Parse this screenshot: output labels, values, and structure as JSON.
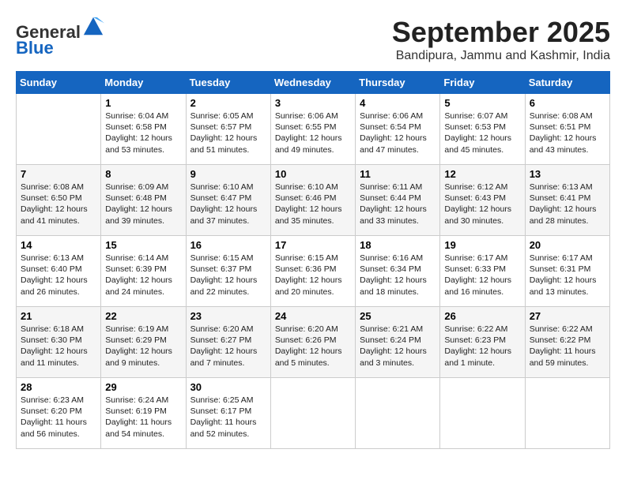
{
  "header": {
    "logo_line1": "General",
    "logo_line2": "Blue",
    "month": "September 2025",
    "location": "Bandipura, Jammu and Kashmir, India"
  },
  "weekdays": [
    "Sunday",
    "Monday",
    "Tuesday",
    "Wednesday",
    "Thursday",
    "Friday",
    "Saturday"
  ],
  "weeks": [
    [
      {
        "day": "",
        "info": ""
      },
      {
        "day": "1",
        "info": "Sunrise: 6:04 AM\nSunset: 6:58 PM\nDaylight: 12 hours\nand 53 minutes."
      },
      {
        "day": "2",
        "info": "Sunrise: 6:05 AM\nSunset: 6:57 PM\nDaylight: 12 hours\nand 51 minutes."
      },
      {
        "day": "3",
        "info": "Sunrise: 6:06 AM\nSunset: 6:55 PM\nDaylight: 12 hours\nand 49 minutes."
      },
      {
        "day": "4",
        "info": "Sunrise: 6:06 AM\nSunset: 6:54 PM\nDaylight: 12 hours\nand 47 minutes."
      },
      {
        "day": "5",
        "info": "Sunrise: 6:07 AM\nSunset: 6:53 PM\nDaylight: 12 hours\nand 45 minutes."
      },
      {
        "day": "6",
        "info": "Sunrise: 6:08 AM\nSunset: 6:51 PM\nDaylight: 12 hours\nand 43 minutes."
      }
    ],
    [
      {
        "day": "7",
        "info": "Sunrise: 6:08 AM\nSunset: 6:50 PM\nDaylight: 12 hours\nand 41 minutes."
      },
      {
        "day": "8",
        "info": "Sunrise: 6:09 AM\nSunset: 6:48 PM\nDaylight: 12 hours\nand 39 minutes."
      },
      {
        "day": "9",
        "info": "Sunrise: 6:10 AM\nSunset: 6:47 PM\nDaylight: 12 hours\nand 37 minutes."
      },
      {
        "day": "10",
        "info": "Sunrise: 6:10 AM\nSunset: 6:46 PM\nDaylight: 12 hours\nand 35 minutes."
      },
      {
        "day": "11",
        "info": "Sunrise: 6:11 AM\nSunset: 6:44 PM\nDaylight: 12 hours\nand 33 minutes."
      },
      {
        "day": "12",
        "info": "Sunrise: 6:12 AM\nSunset: 6:43 PM\nDaylight: 12 hours\nand 30 minutes."
      },
      {
        "day": "13",
        "info": "Sunrise: 6:13 AM\nSunset: 6:41 PM\nDaylight: 12 hours\nand 28 minutes."
      }
    ],
    [
      {
        "day": "14",
        "info": "Sunrise: 6:13 AM\nSunset: 6:40 PM\nDaylight: 12 hours\nand 26 minutes."
      },
      {
        "day": "15",
        "info": "Sunrise: 6:14 AM\nSunset: 6:39 PM\nDaylight: 12 hours\nand 24 minutes."
      },
      {
        "day": "16",
        "info": "Sunrise: 6:15 AM\nSunset: 6:37 PM\nDaylight: 12 hours\nand 22 minutes."
      },
      {
        "day": "17",
        "info": "Sunrise: 6:15 AM\nSunset: 6:36 PM\nDaylight: 12 hours\nand 20 minutes."
      },
      {
        "day": "18",
        "info": "Sunrise: 6:16 AM\nSunset: 6:34 PM\nDaylight: 12 hours\nand 18 minutes."
      },
      {
        "day": "19",
        "info": "Sunrise: 6:17 AM\nSunset: 6:33 PM\nDaylight: 12 hours\nand 16 minutes."
      },
      {
        "day": "20",
        "info": "Sunrise: 6:17 AM\nSunset: 6:31 PM\nDaylight: 12 hours\nand 13 minutes."
      }
    ],
    [
      {
        "day": "21",
        "info": "Sunrise: 6:18 AM\nSunset: 6:30 PM\nDaylight: 12 hours\nand 11 minutes."
      },
      {
        "day": "22",
        "info": "Sunrise: 6:19 AM\nSunset: 6:29 PM\nDaylight: 12 hours\nand 9 minutes."
      },
      {
        "day": "23",
        "info": "Sunrise: 6:20 AM\nSunset: 6:27 PM\nDaylight: 12 hours\nand 7 minutes."
      },
      {
        "day": "24",
        "info": "Sunrise: 6:20 AM\nSunset: 6:26 PM\nDaylight: 12 hours\nand 5 minutes."
      },
      {
        "day": "25",
        "info": "Sunrise: 6:21 AM\nSunset: 6:24 PM\nDaylight: 12 hours\nand 3 minutes."
      },
      {
        "day": "26",
        "info": "Sunrise: 6:22 AM\nSunset: 6:23 PM\nDaylight: 12 hours\nand 1 minute."
      },
      {
        "day": "27",
        "info": "Sunrise: 6:22 AM\nSunset: 6:22 PM\nDaylight: 11 hours\nand 59 minutes."
      }
    ],
    [
      {
        "day": "28",
        "info": "Sunrise: 6:23 AM\nSunset: 6:20 PM\nDaylight: 11 hours\nand 56 minutes."
      },
      {
        "day": "29",
        "info": "Sunrise: 6:24 AM\nSunset: 6:19 PM\nDaylight: 11 hours\nand 54 minutes."
      },
      {
        "day": "30",
        "info": "Sunrise: 6:25 AM\nSunset: 6:17 PM\nDaylight: 11 hours\nand 52 minutes."
      },
      {
        "day": "",
        "info": ""
      },
      {
        "day": "",
        "info": ""
      },
      {
        "day": "",
        "info": ""
      },
      {
        "day": "",
        "info": ""
      }
    ]
  ]
}
